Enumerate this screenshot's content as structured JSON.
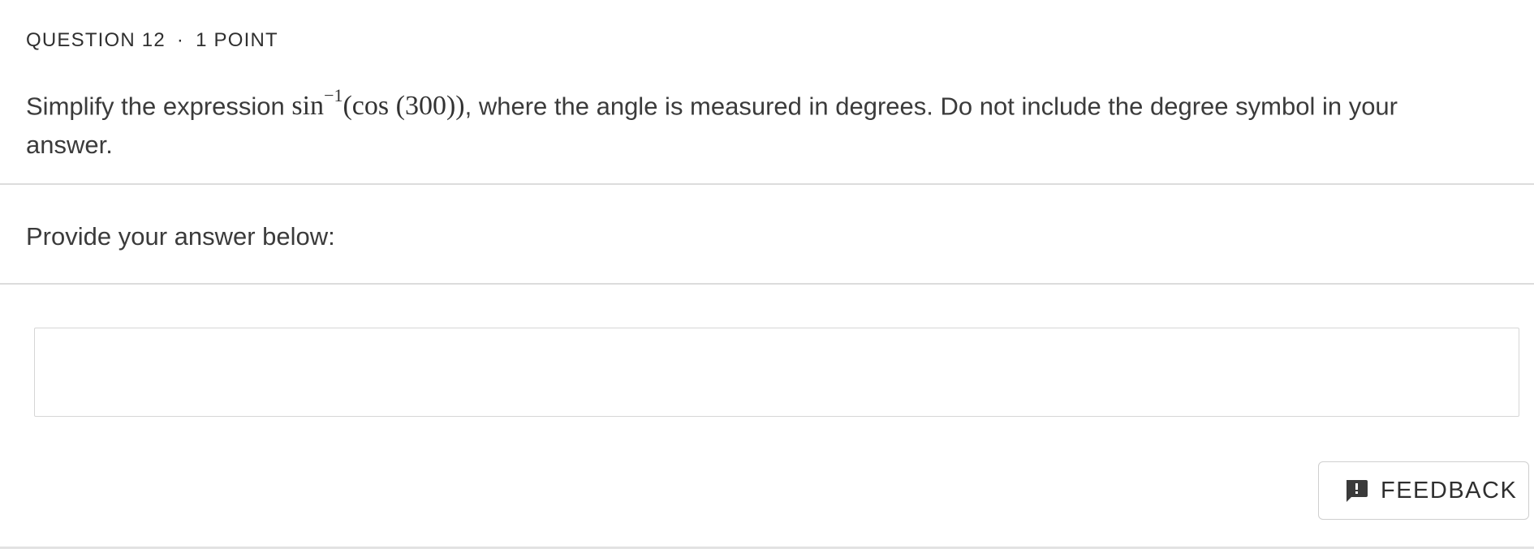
{
  "question": {
    "number_label": "QUESTION 12",
    "separator": "·",
    "points_label": "1 POINT",
    "text_before": "Simplify the expression ",
    "math_func": "sin",
    "math_sup": "−1",
    "math_rest": "(cos (300))",
    "text_after": ", where the angle is measured in degrees. Do not include the degree symbol in your answer."
  },
  "answer": {
    "prompt": "Provide your answer below:",
    "value": "",
    "placeholder": ""
  },
  "feedback": {
    "label": "FEEDBACK",
    "icon": "feedback-speech-bubble-icon"
  },
  "colors": {
    "text": "#3b3b3b",
    "divider": "#dcdcdc",
    "border": "#d6d6d6"
  }
}
